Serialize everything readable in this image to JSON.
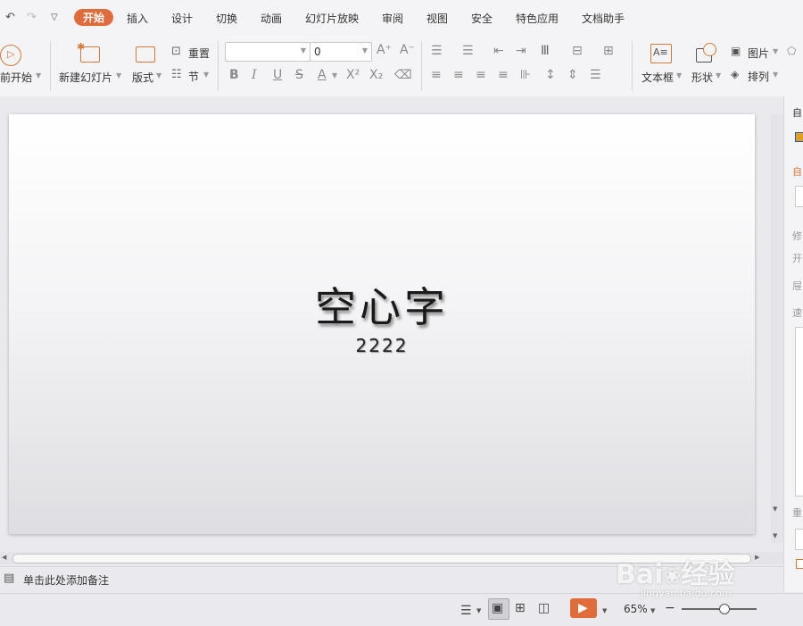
{
  "tabs": [
    "开始",
    "插入",
    "设计",
    "切换",
    "动画",
    "幻灯片放映",
    "审阅",
    "视图",
    "安全",
    "特色应用",
    "文档助手"
  ],
  "ribbon": {
    "from_start": "前开始",
    "new_slide": "新建幻灯片",
    "layout": "版式",
    "reset": "重置",
    "section": "节",
    "font_name": "",
    "font_size": "0",
    "text_box": "文本框",
    "shape": "形状",
    "picture": "图片",
    "arrange": "排列"
  },
  "slide": {
    "title": "空心字",
    "subtitle": "2222"
  },
  "notes": {
    "placeholder": "单击此处添加备注"
  },
  "status": {
    "zoom": "65%"
  },
  "right_panel": [
    "自",
    "修",
    "开",
    "屉",
    "速",
    "重"
  ],
  "watermark": {
    "main": "Bai du 经验",
    "sub": "jingyan.baidu.com"
  },
  "colors": {
    "accent": "#e06c3b",
    "ribbon_bg": "#f4f4f6",
    "canvas_bg": "#eaeaee"
  }
}
